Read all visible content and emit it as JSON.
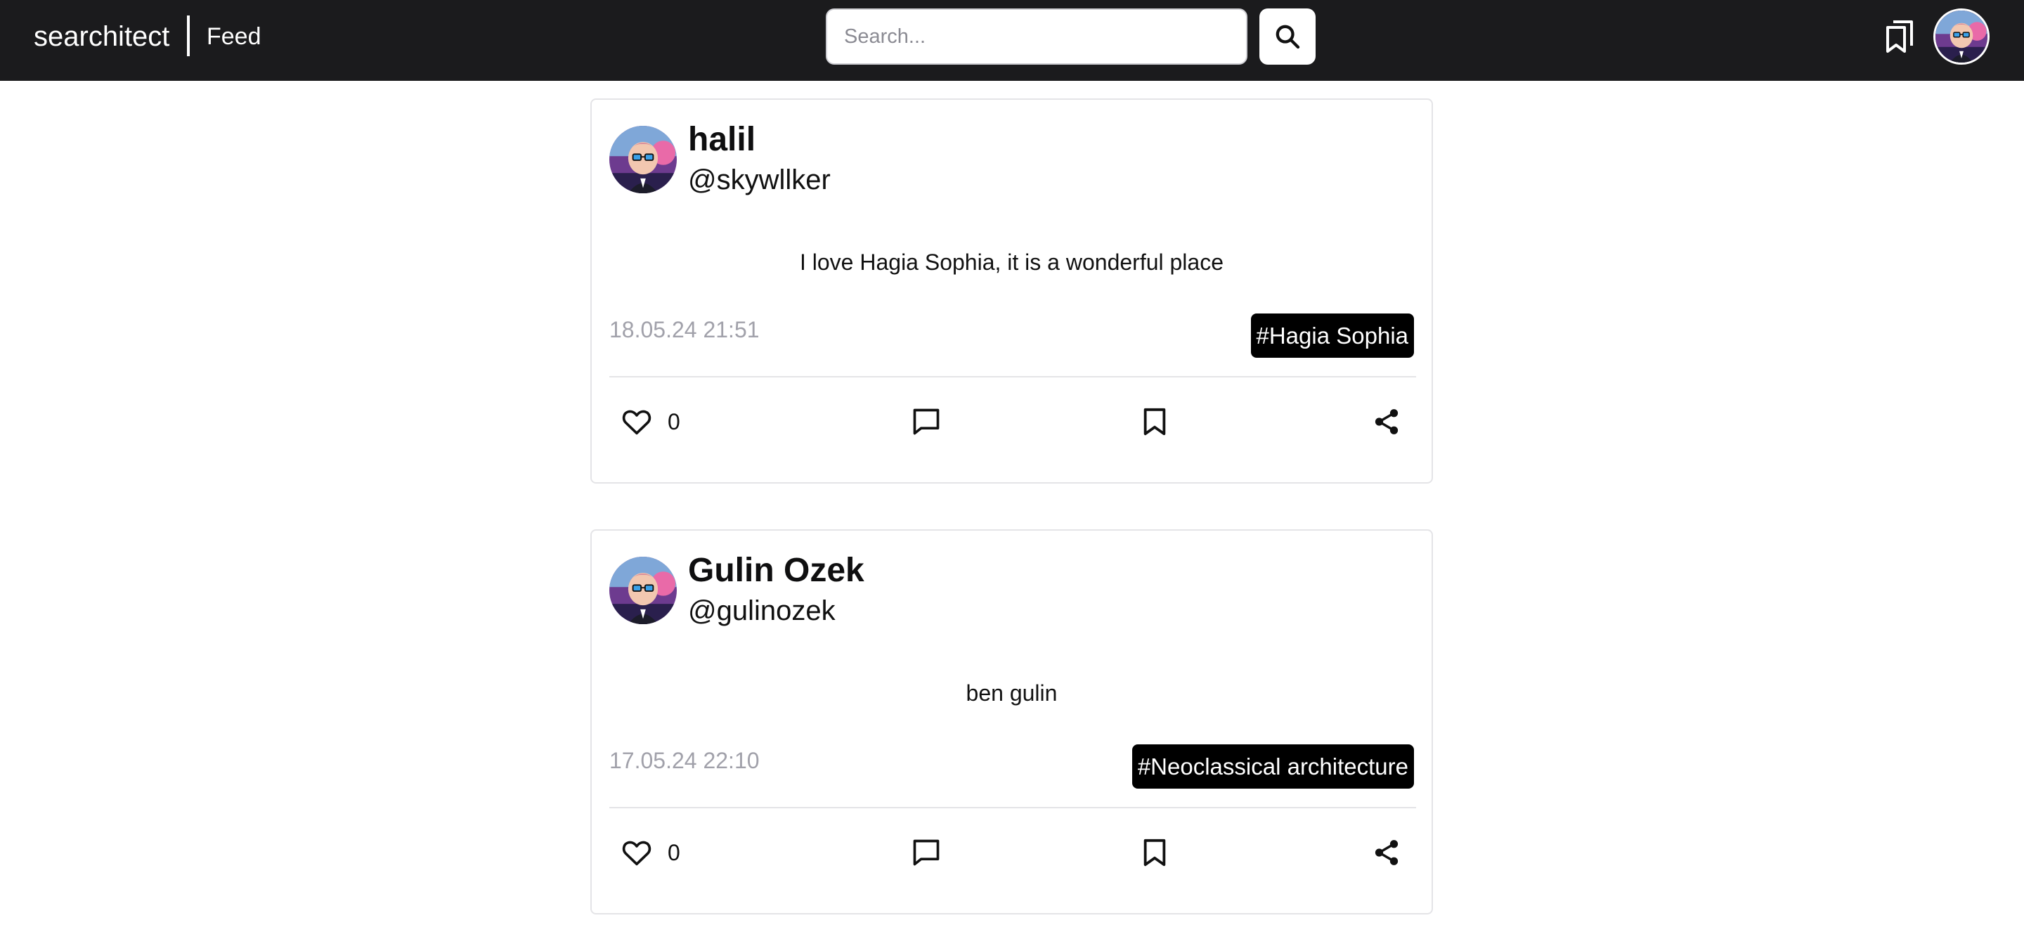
{
  "header": {
    "brand": "searchitect",
    "section": "Feed",
    "search_placeholder": "Search...",
    "search_icon": "search-icon",
    "bookmarks_icon": "bookmarks-icon",
    "avatar": "user-avatar"
  },
  "posts": [
    {
      "author": "halil",
      "handle": "@skywllker",
      "text": "I love Hagia Sophia, it is a wonderful place",
      "date": "18.05.24 21:51",
      "tag": "#Hagia Sophia",
      "likes": "0"
    },
    {
      "author": "Gulin Ozek",
      "handle": "@gulinozek",
      "text": "ben gulin",
      "date": "17.05.24 22:10",
      "tag": "#Neoclassical architecture",
      "likes": "0"
    }
  ],
  "colors": {
    "topbar": "#1b1b1d",
    "tag_background": "#000000",
    "date_text": "#a1a1aa",
    "card_border": "#e4e4e7"
  }
}
